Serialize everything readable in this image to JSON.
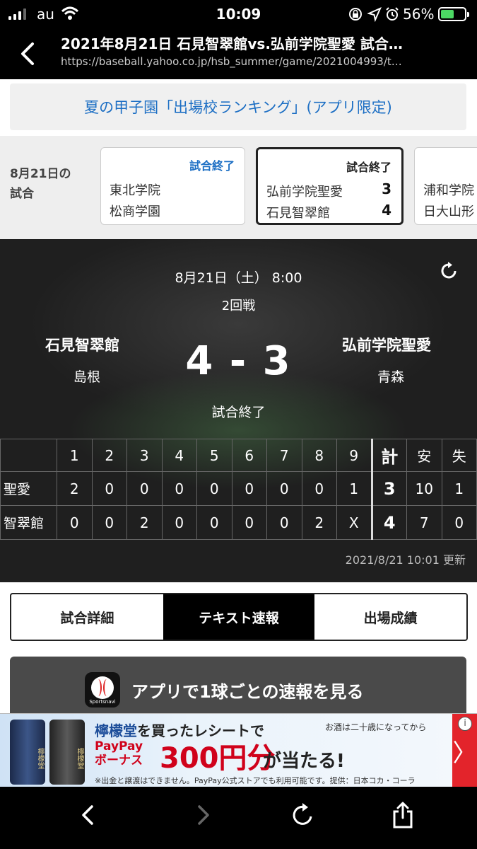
{
  "status_bar": {
    "carrier": "au",
    "time": "10:09",
    "battery_pct": "56%",
    "battery_level": 0.56
  },
  "nav": {
    "title": "2021年8月21日 石見智翠館vs.弘前学院聖愛 試合…",
    "url": "https://baseball.yahoo.co.jp/hsb_summer/game/2021004993/t…"
  },
  "banner": {
    "label": "夏の甲子園「出場校ランキング」(アプリ限定)"
  },
  "games_strip": {
    "day_label_1": "8月21日の",
    "day_label_2": "試合",
    "cards": [
      {
        "status": "試合終了",
        "team1": "東北学院",
        "team2": "松商学園",
        "score1": "",
        "score2": ""
      },
      {
        "status": "試合終了",
        "team1": "弘前学院聖愛",
        "team2": "石見智翠館",
        "score1": "3",
        "score2": "4"
      },
      {
        "status": "",
        "team1": "浦和学院",
        "team2": "日大山形",
        "score1": "",
        "score2": ""
      }
    ]
  },
  "game": {
    "datetime": "8月21日（土） 8:00",
    "round": "2回戦",
    "home_team": "石見智翠館",
    "home_pref": "島根",
    "away_team": "弘前学院聖愛",
    "away_pref": "青森",
    "score_display": "4 - 3",
    "status": "試合終了",
    "updated": "2021/8/21 10:01 更新"
  },
  "linescore": {
    "headers": [
      "",
      "1",
      "2",
      "3",
      "4",
      "5",
      "6",
      "7",
      "8",
      "9",
      "計",
      "安",
      "失"
    ],
    "rows": [
      {
        "team": "聖愛",
        "innings": [
          "2",
          "0",
          "0",
          "0",
          "0",
          "0",
          "0",
          "0",
          "1"
        ],
        "total": "3",
        "hits": "10",
        "errors": "1"
      },
      {
        "team": "智翠館",
        "innings": [
          "0",
          "0",
          "2",
          "0",
          "0",
          "0",
          "0",
          "2",
          "X"
        ],
        "total": "4",
        "hits": "7",
        "errors": "0"
      }
    ]
  },
  "tabs": [
    {
      "label": "試合詳細",
      "selected": false
    },
    {
      "label": "テキスト速報",
      "selected": true
    },
    {
      "label": "出場成績",
      "selected": false
    }
  ],
  "app_button": {
    "label": "アプリで1球ごとの速報を見る",
    "icon_caption": "Sportsnavi"
  },
  "ad": {
    "can_label_1": "檸檬堂",
    "can_label_2": "檸檬堂",
    "line1_prefix": "檸檬堂",
    "line1_suffix": "を買ったレシートで",
    "age_notice": "お酒は二十歳になってから",
    "paypay_1": "PayPay",
    "paypay_2": "ボーナス",
    "amount": "300円分",
    "tail": "が当たる!",
    "fine_print": "※出金と譲渡はできません。PayPay公式ストアでも利用可能です。提供：日本コカ・コーラ",
    "arrow": "〉",
    "info": "i"
  },
  "colors": {
    "accent_blue": "#1d6fc4",
    "brand_red": "#e3242b"
  },
  "icons": [
    "signal-icon",
    "wifi-icon",
    "lock-rotation-icon",
    "location-icon",
    "alarm-icon",
    "battery-icon",
    "back-chevron-icon",
    "refresh-icon",
    "forward-chevron-icon",
    "reload-icon",
    "share-icon"
  ]
}
